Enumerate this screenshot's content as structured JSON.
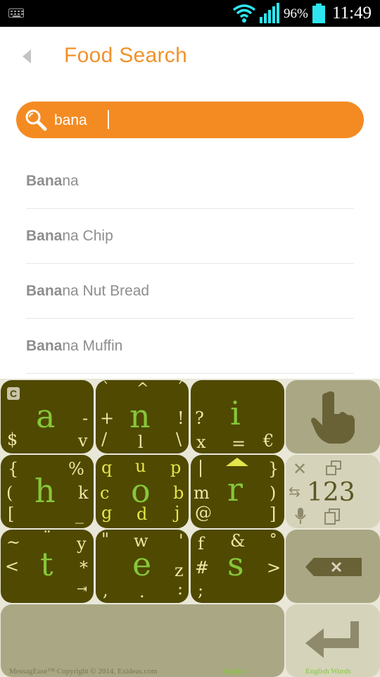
{
  "status_bar": {
    "battery_percent": "96%",
    "battery_level": 0.96,
    "time": "11:49",
    "icons": [
      "keyboard-icon",
      "wifi-icon",
      "signal-icon",
      "battery-icon"
    ]
  },
  "header": {
    "back_icon": "back-arrow-icon",
    "title": "Food Search"
  },
  "search": {
    "icon": "search-icon",
    "value": "bana",
    "accent_color": "#f48b22"
  },
  "results": [
    {
      "match": "Bana",
      "rest": "na"
    },
    {
      "match": "Bana",
      "rest": "na Chip"
    },
    {
      "match": "Bana",
      "rest": "na Nut Bread"
    },
    {
      "match": "Bana",
      "rest": "na Muffin"
    }
  ],
  "keyboard": {
    "colors": {
      "dark_key": "#4f4902",
      "light_key": "#aaa784",
      "primary_letter": "#86c73a",
      "secondary": "#efe7a4"
    },
    "keys": {
      "a": {
        "main": "a",
        "tl": "C",
        "tr": "-",
        "bl": "$",
        "br": "v"
      },
      "n": {
        "main": "n",
        "tl": "`",
        "t": "^",
        "tr": "´",
        "l": "+",
        "r": "!",
        "bl": "/",
        "b": "l",
        "br": "\\"
      },
      "i": {
        "main": "i",
        "tl": "?",
        "bl": "x",
        "b": "=",
        "br": "€"
      },
      "h": {
        "main": "h",
        "tl": "{",
        "tr": "%",
        "l": "(",
        "r": "k",
        "bl": "[",
        "br": "_"
      },
      "o": {
        "main": "o",
        "tl": "q",
        "t": "u",
        "tr": "p",
        "l": "c",
        "r": "b",
        "bl": "g",
        "b": "d",
        "br": "j"
      },
      "r": {
        "main": "r",
        "tl": "|",
        "tr": "}",
        "l": "m",
        "r": ")",
        "bl": "@",
        "br": "]"
      },
      "t": {
        "main": "t",
        "tl": "~",
        "t": "¨",
        "tr": "y",
        "l": "<",
        "r": "*",
        "br": "⇥"
      },
      "e": {
        "main": "e",
        "tl": "\"",
        "t": "w",
        "tr": "'",
        "r": "z",
        "bl": ",",
        "b": ".",
        "br": ":"
      },
      "s": {
        "main": "s",
        "tl": "f",
        "t": "&",
        "tr": "°",
        "l": "#",
        "r": ">",
        "bl": ";"
      }
    },
    "numbers_label": "123",
    "copyright": "MessagEase™ Copyright © 2014, Exideas.com",
    "language": "English",
    "dictionary": "English Words"
  }
}
